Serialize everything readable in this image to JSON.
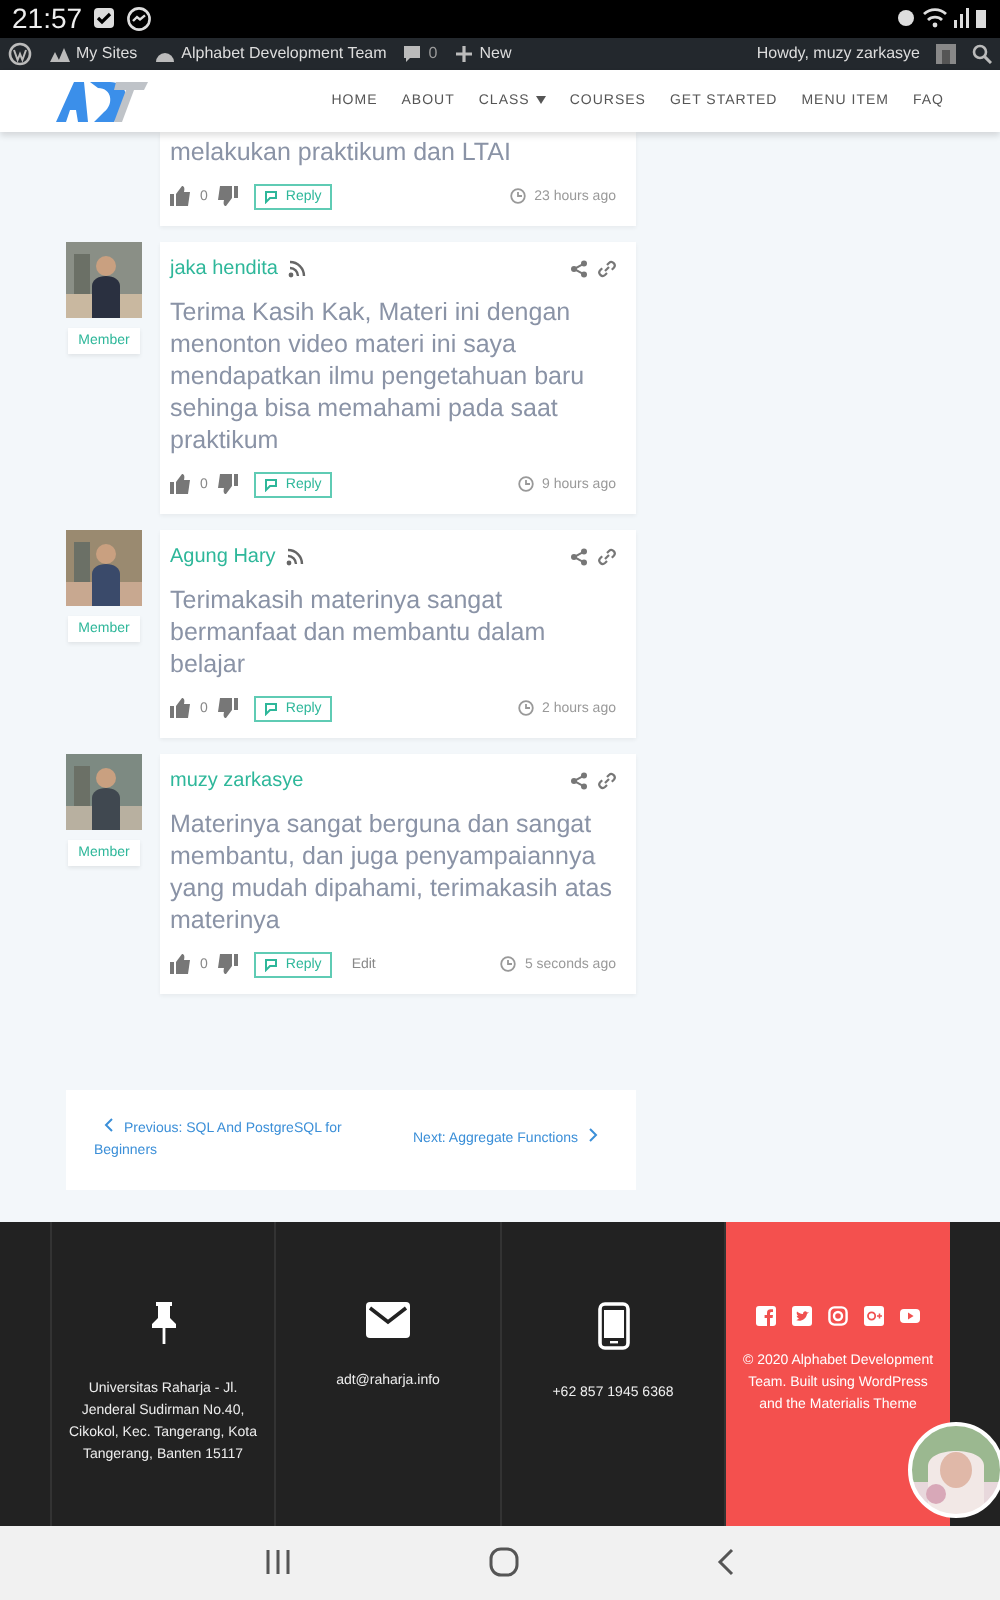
{
  "status_bar": {
    "time": "21:57"
  },
  "admin_bar": {
    "items": [
      {
        "kind": "sites",
        "label": "My Sites"
      },
      {
        "kind": "site",
        "label": "Alphabet Development Team"
      },
      {
        "kind": "comments",
        "label": "0"
      },
      {
        "kind": "new",
        "label": "New"
      }
    ],
    "greeting": "Howdy, muzy zarkasye"
  },
  "header": {
    "menu": [
      {
        "label": "HOME",
        "dropdown": false
      },
      {
        "label": "ABOUT",
        "dropdown": false
      },
      {
        "label": "CLASS",
        "dropdown": true
      },
      {
        "label": "COURSES",
        "dropdown": false
      },
      {
        "label": "GET STARTED",
        "dropdown": false
      },
      {
        "label": "MENU ITEM",
        "dropdown": false
      },
      {
        "label": "FAQ",
        "dropdown": false
      }
    ]
  },
  "comments": [
    {
      "kind": "partial",
      "text": "melakukan praktikum dan LTAI",
      "likes": "0",
      "reply": "Reply",
      "time": "23 hours ago"
    },
    {
      "kind": "full",
      "author": "jaka hendita",
      "role": "Member",
      "rss": true,
      "text": "Terima Kasih Kak, Materi ini dengan menonton video materi ini saya mendapatkan ilmu pengetahuan baru sehinga bisa memahami pada saat praktikum",
      "likes": "0",
      "reply": "Reply",
      "time": "9 hours ago"
    },
    {
      "kind": "full",
      "author": "Agung Hary",
      "role": "Member",
      "rss": true,
      "text": "Terimakasih materinya sangat bermanfaat dan membantu dalam belajar",
      "likes": "0",
      "reply": "Reply",
      "time": "2 hours ago"
    },
    {
      "kind": "full",
      "author": "muzy zarkasye",
      "role": "Member",
      "rss": false,
      "text": "Materinya sangat berguna dan sangat membantu, dan juga penyampaiannya yang mudah dipahami, terimakasih atas materinya",
      "likes": "0",
      "reply": "Reply",
      "edit": "Edit",
      "time": "5 seconds ago"
    }
  ],
  "post_nav": {
    "previous": "Previous: SQL And PostgreSQL for Beginners",
    "next": "Next: Aggregate Functions"
  },
  "footer": {
    "columns": [
      {
        "kind": "pin",
        "text": "Universitas Raharja - Jl. Jenderal Sudirman No.40, Cikokol, Kec. Tangerang, Kota Tangerang, Banten 15117"
      },
      {
        "kind": "mail",
        "text": "adt@raharja.info"
      },
      {
        "kind": "phone",
        "text": "+62 857 1945 6368"
      }
    ],
    "social": [
      {
        "kind": "facebook"
      },
      {
        "kind": "twitter"
      },
      {
        "kind": "instagram"
      },
      {
        "kind": "google-plus"
      },
      {
        "kind": "youtube"
      }
    ],
    "copyright": "©  2020 Alphabet Development Team. Built using WordPress and the Materialis Theme"
  }
}
